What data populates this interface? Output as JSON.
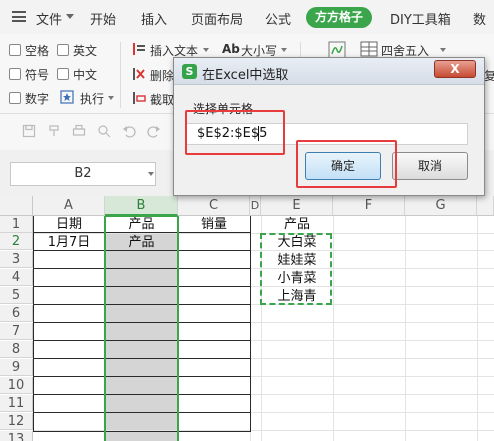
{
  "menu": {
    "items": [
      {
        "label": "文件"
      },
      {
        "label": "开始"
      },
      {
        "label": "插入"
      },
      {
        "label": "页面布局"
      },
      {
        "label": "公式"
      },
      {
        "label": "方方格子"
      },
      {
        "label": "DIY工具箱"
      },
      {
        "label": "数"
      }
    ],
    "active": "方方格子"
  },
  "ribbon": {
    "checkboxes": [
      {
        "label": "空格"
      },
      {
        "label": "英文"
      },
      {
        "label": "符号"
      },
      {
        "label": "中文"
      },
      {
        "label": "数字"
      }
    ],
    "execute_label": "执行",
    "insert_text_label": "插入文本",
    "case_label": "大小写",
    "case_prefix": "Ab",
    "delete_label": "删除",
    "cut_label": "截取",
    "round_label": "四舍五入",
    "side_text": "复"
  },
  "name_box": {
    "value": "B2"
  },
  "grid": {
    "columns": [
      "A",
      "B",
      "C",
      "D",
      "E",
      "F",
      "G"
    ],
    "rows": [
      "1",
      "2",
      "3",
      "4",
      "5",
      "6",
      "7",
      "8",
      "9",
      "10",
      "11",
      "12",
      "13"
    ],
    "selected_column": "B",
    "header": {
      "A": "日期",
      "B": "产品",
      "C": "销量",
      "E": "产品"
    },
    "row2": {
      "A": "1月7日",
      "B": "产品"
    },
    "e_values": [
      "大白菜",
      "娃娃菜",
      "小青菜",
      "上海青"
    ]
  },
  "dialog": {
    "title": "在Excel中选取",
    "logo": "S",
    "close_label": "X",
    "label": "选择单元格",
    "input_value": "$E$2:$E$5",
    "ok_label": "确定",
    "cancel_label": "取消"
  },
  "colors": {
    "accent": "#3aa54b",
    "highlight": "#e83b3b"
  }
}
